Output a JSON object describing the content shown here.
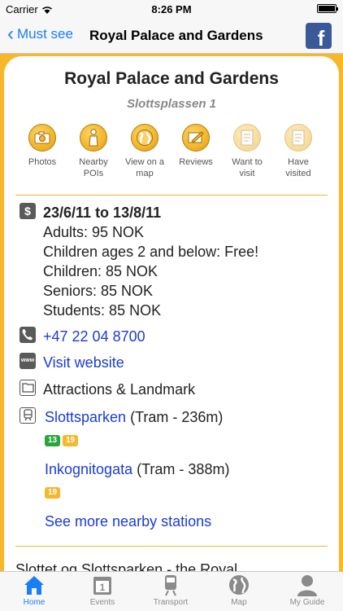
{
  "status_bar": {
    "carrier": "Carrier",
    "time": "8:26 PM"
  },
  "nav": {
    "back_label": "Must see",
    "title": "Royal Palace and Gardens"
  },
  "place": {
    "title": "Royal Palace and Gardens",
    "address": "Slottsplassen 1"
  },
  "actions": [
    {
      "label_1": "Photos",
      "label_2": "",
      "icon": "camera-icon"
    },
    {
      "label_1": "Nearby",
      "label_2": "POIs",
      "icon": "person-icon"
    },
    {
      "label_1": "View on a",
      "label_2": "map",
      "icon": "globe-icon"
    },
    {
      "label_1": "Reviews",
      "label_2": "",
      "icon": "pencil-icon"
    },
    {
      "label_1": "Want to",
      "label_2": "visit",
      "icon": "note-icon"
    },
    {
      "label_1": "Have",
      "label_2": "visited",
      "icon": "note-icon"
    }
  ],
  "prices": {
    "icon": "$",
    "dates": "23/6/11 to 13/8/11",
    "lines": [
      "Adults: 95 NOK",
      "Children ages 2 and below: Free!",
      "Children: 85 NOK",
      "Seniors: 85 NOK",
      "Students: 85 NOK"
    ]
  },
  "phone": "+47 22 04 8700",
  "website_icon": "www",
  "website": "Visit website",
  "category": "Attractions & Landmark",
  "stations": [
    {
      "name": "Slottsparken",
      "detail": "(Tram - 236m)",
      "lines": [
        "13",
        "19"
      ]
    },
    {
      "name": "Inkognitogata",
      "detail": "(Tram - 388m)",
      "lines": [
        "19"
      ]
    }
  ],
  "see_more": "See more nearby stations",
  "tail_text": "Slottet og Slottsparken - the Royal",
  "tabs": [
    {
      "label": "Home",
      "icon": "home-icon"
    },
    {
      "label": "Events",
      "icon": "calendar-icon"
    },
    {
      "label": "Transport",
      "icon": "train-icon"
    },
    {
      "label": "Map",
      "icon": "globe-icon"
    },
    {
      "label": "My Guide",
      "icon": "user-icon"
    }
  ],
  "colors": {
    "accent": "#1a7ef7",
    "brand": "#f7b72a",
    "link": "#1a3bd6"
  }
}
